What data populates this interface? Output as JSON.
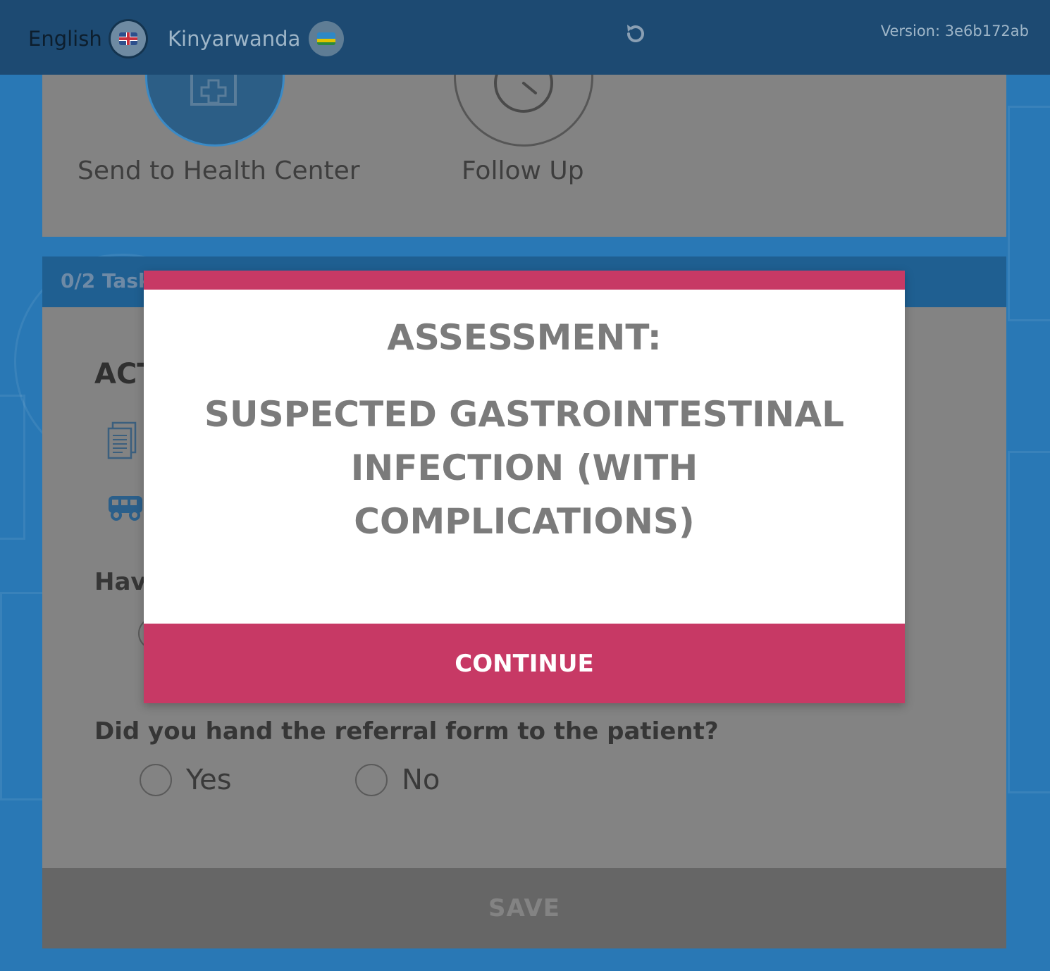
{
  "header": {
    "languages": [
      {
        "label": "English",
        "flag": "uk-flag-icon",
        "active": true
      },
      {
        "label": "Kinyarwanda",
        "flag": "rwanda-flag-icon",
        "active": false
      }
    ],
    "version": "Version: 3e6b172ab"
  },
  "activities": [
    {
      "label": "Send to Health Center",
      "icon": "health-center-icon",
      "selected": true
    },
    {
      "label": "Follow Up",
      "icon": "clock-icon",
      "selected": false
    }
  ],
  "tasks": {
    "counter": "0/2 Task"
  },
  "form": {
    "section_title": "ACT",
    "question_partial": "Hav",
    "question_referral": "Did you hand the referral form to the patient?",
    "options": [
      "Yes",
      "No"
    ],
    "save_label": "SAVE"
  },
  "modal": {
    "title": "ASSESSMENT:",
    "message": "SUSPECTED GASTROINTESTINAL INFECTION (WITH COMPLICATIONS)",
    "button_label": "CONTINUE"
  },
  "colors": {
    "accent": "#c73965",
    "header_bg": "#1d4a72",
    "app_bg": "#2978b5"
  }
}
